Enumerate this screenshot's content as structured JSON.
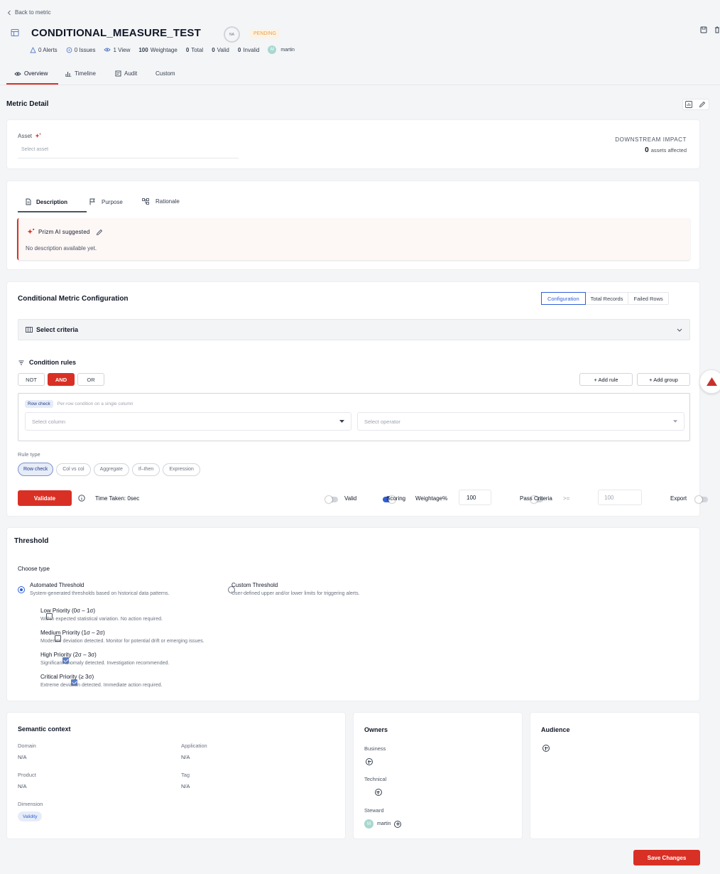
{
  "header": {
    "back_label": "Back to metric",
    "title": "CONDITIONAL_MEASURE_TEST",
    "score_badge": "NA",
    "status": "PENDING",
    "stats": {
      "alerts": "0 Alerts",
      "issues": "0 Issues",
      "views": "1 View",
      "weightage_num": "100",
      "weightage_label": "Weightage",
      "total_num": "0",
      "total_label": "Total",
      "valid_num": "0",
      "valid_label": "Valid",
      "invalid_num": "0",
      "invalid_label": "Invalid",
      "owner_initial": "M",
      "owner": "martin"
    }
  },
  "tabs": [
    "Overview",
    "Timeline",
    "Audit",
    "Custom"
  ],
  "metric_detail": {
    "title": "Metric Detail",
    "asset_label": "Asset",
    "asset_placeholder": "Select asset",
    "downstream_title": "DOWNSTREAM IMPACT",
    "downstream_count": "0",
    "downstream_suffix": "assets affected"
  },
  "description": {
    "tabs": [
      "Description",
      "Purpose",
      "Rationale"
    ],
    "ai_label": "Prizm AI suggested",
    "text": "No description available yet."
  },
  "config": {
    "title": "Conditional Metric Configuration",
    "view_tabs": [
      "Configuration",
      "Total Records",
      "Failed Rows"
    ],
    "select_criteria": "Select criteria",
    "condition_rules": "Condition rules",
    "logic_buttons": [
      "NOT",
      "AND",
      "OR"
    ],
    "add_rule": "+ Add rule",
    "add_group": "+ Add group",
    "row_check_tag": "Row check",
    "row_check_desc": "Per-row condition on a single column",
    "select_column": "Select column",
    "select_operator": "Select operator",
    "rule_type_label": "Rule type",
    "rule_types": [
      "Row check",
      "Col vs col",
      "Aggregate",
      "If–then",
      "Expression"
    ],
    "validate": "Validate",
    "time_taken": "Time Taken: 0sec",
    "valid_label": "Valid",
    "scoring_label": "Scoring",
    "weightage_label": "Weightage%",
    "weightage_value": "100",
    "pass_criteria_label": "Pass Criteria",
    "pass_op": ">=",
    "pass_value": "100",
    "export_label": "Export"
  },
  "threshold": {
    "title": "Threshold",
    "choose_type": "Choose type",
    "automated_title": "Automated Threshold",
    "automated_desc": "System-generated thresholds based on historical data patterns.",
    "custom_title": "Custom Threshold",
    "custom_desc": "User-defined upper and/or lower limits for triggering alerts.",
    "priorities": [
      {
        "title": "Low Priority (0σ – 1σ)",
        "desc": "Within expected statistical variation. No action required.",
        "checked": false
      },
      {
        "title": "Medium Priority (1σ – 2σ)",
        "desc": "Moderate deviation detected. Monitor for potential drift or emerging issues.",
        "checked": false
      },
      {
        "title": "High Priority (2σ – 3σ)",
        "desc": "Significant anomaly detected. Investigation recommended.",
        "checked": true
      },
      {
        "title": "Critical Priority (≥ 3σ)",
        "desc": "Extreme deviation detected. Immediate action required.",
        "checked": true
      }
    ]
  },
  "semantic": {
    "title": "Semantic context",
    "domain_label": "Domain",
    "domain_value": "N/A",
    "application_label": "Application",
    "application_value": "N/A",
    "product_label": "Product",
    "product_value": "N/A",
    "tag_label": "Tag",
    "tag_value": "N/A",
    "dimension_label": "Dimension",
    "dimension_value": "Validity"
  },
  "owners": {
    "title": "Owners",
    "business": "Business",
    "technical": "Technical",
    "steward": "Steward",
    "steward_initial": "M",
    "steward_name": "martin"
  },
  "audience": {
    "title": "Audience"
  },
  "save": "Save Changes",
  "colors": {
    "accent": "#d93025",
    "primary": "#2f5fd7",
    "pending": "#e8a24a"
  }
}
